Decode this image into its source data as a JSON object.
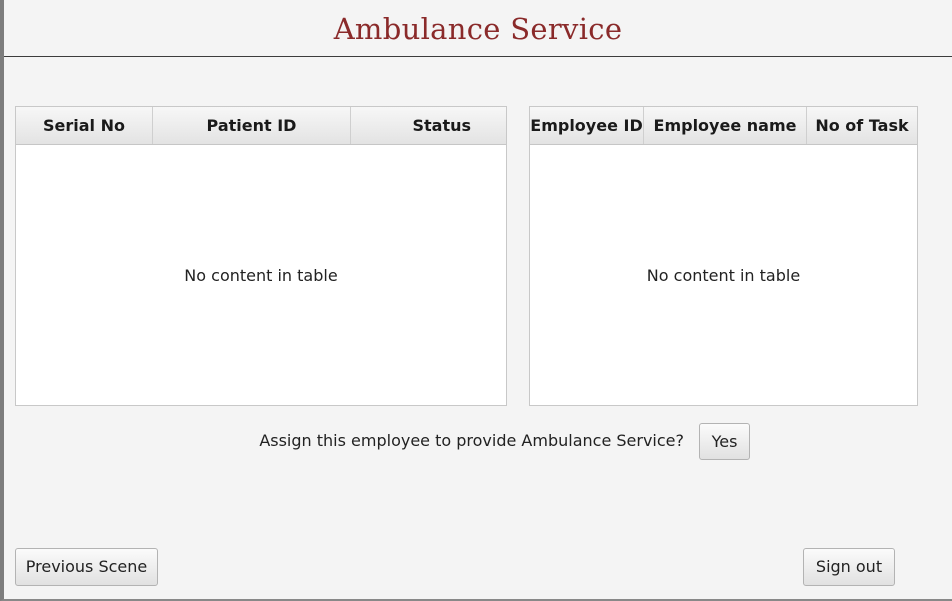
{
  "window": {
    "title": "Ambulance Service"
  },
  "patients_table": {
    "columns": [
      "Serial No",
      "Patient ID",
      "Status"
    ],
    "empty_text": "No content in table"
  },
  "employees_table": {
    "columns": [
      "Employee ID",
      "Employee name",
      "No of Task"
    ],
    "empty_text": "No content in table"
  },
  "assign": {
    "prompt": "Assign this employee to provide Ambulance Service?",
    "yes_label": "Yes"
  },
  "footer": {
    "previous_label": "Previous Scene",
    "signout_label": "Sign out"
  }
}
